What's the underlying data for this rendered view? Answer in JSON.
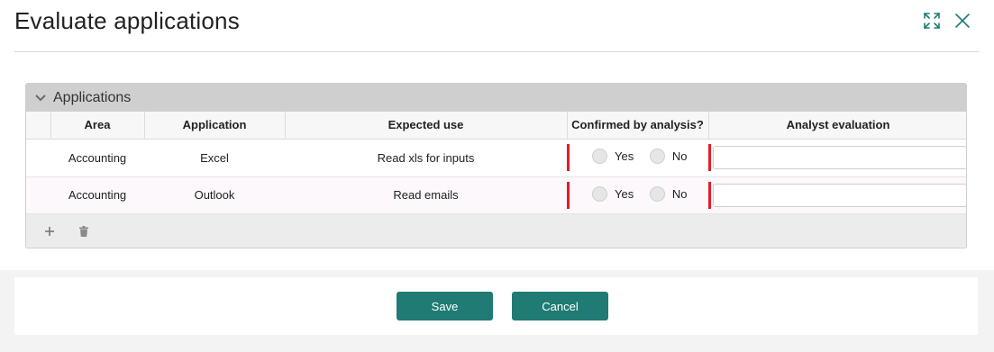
{
  "dialog": {
    "title": "Evaluate applications",
    "icons": {
      "expand": "expand-icon",
      "close": "close-icon"
    }
  },
  "panel": {
    "title": "Applications",
    "columns": [
      "",
      "Area",
      "Application",
      "Expected use",
      "Confirmed by analysis?",
      "Analyst evaluation"
    ],
    "rows": [
      {
        "area": "Accounting",
        "application": "Excel",
        "expected_use": "Read xls for inputs",
        "confirm_yes": "Yes",
        "confirm_no": "No",
        "evaluation": ""
      },
      {
        "area": "Accounting",
        "application": "Outlook",
        "expected_use": "Read emails",
        "confirm_yes": "Yes",
        "confirm_no": "No",
        "evaluation": ""
      }
    ],
    "footer_icons": {
      "add": "plus-icon",
      "delete": "trash-icon"
    }
  },
  "footer": {
    "save_label": "Save",
    "cancel_label": "Cancel"
  },
  "colors": {
    "accent": "#1f7b74",
    "required": "#e31e24",
    "panel_header": "#cfcfcf"
  }
}
